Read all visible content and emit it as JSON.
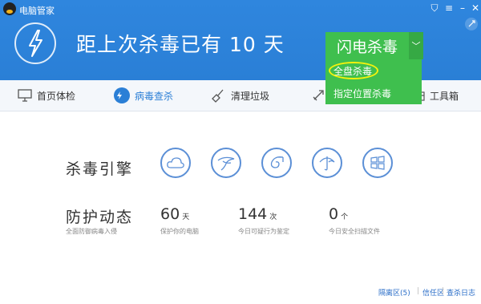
{
  "app": {
    "title": "电脑管家"
  },
  "header": {
    "headline": "距上次杀毒已有 10 天",
    "scan_button": "闪电杀毒"
  },
  "dropdown": {
    "items": [
      "全盘杀毒",
      "指定位置杀毒"
    ]
  },
  "nav": {
    "items": [
      {
        "label": "首页体检"
      },
      {
        "label": "病毒查杀"
      },
      {
        "label": "清理垃圾"
      },
      {
        "label": "工具箱"
      }
    ]
  },
  "engine": {
    "label": "杀毒引擎"
  },
  "protection": {
    "label": "防护动态",
    "sub": "全面防御病毒入侵",
    "stats": [
      {
        "value": "60",
        "unit": "天",
        "desc": "保护你的电脑"
      },
      {
        "value": "144",
        "unit": "次",
        "desc": "今日可疑行为鉴定"
      },
      {
        "value": "0",
        "unit": "个",
        "desc": "今日安全扫描文件"
      }
    ]
  },
  "footer": {
    "links": [
      "隔离区(5)",
      "信任区",
      "查杀日志"
    ]
  },
  "colors": {
    "header_blue": "#2f86de",
    "green": "#3fbf4e",
    "highlight": "#f5f20d",
    "link": "#2b6ec8"
  }
}
